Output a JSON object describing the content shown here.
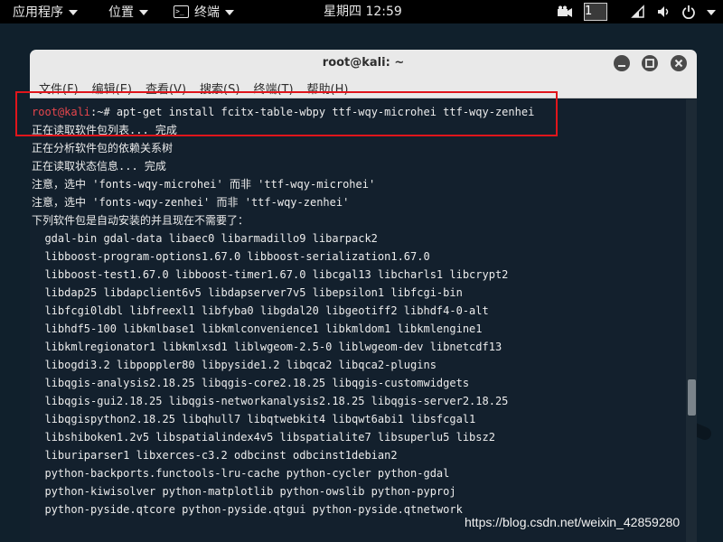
{
  "top_panel": {
    "apps_label": "应用程序",
    "places_label": "位置",
    "terminal_label": "终端",
    "clock": "星期四 12:59",
    "workspace": "1",
    "icons": [
      "camera-icon",
      "network-icon",
      "volume-icon",
      "power-icon"
    ]
  },
  "window": {
    "title": "root@kali: ~",
    "menus": [
      "文件(F)",
      "编辑(E)",
      "查看(V)",
      "搜索(S)",
      "终端(T)",
      "帮助(H)"
    ]
  },
  "terminal": {
    "prompt_user": "root@kali",
    "prompt_rest": ":~# apt-get install fcitx-table-wbpy ttf-wqy-microhei ttf-wqy-zenhei",
    "lines": [
      "正在读取软件包列表... 完成",
      "正在分析软件包的依赖关系树",
      "正在读取状态信息... 完成",
      "注意，选中 'fonts-wqy-microhei' 而非 'ttf-wqy-microhei'",
      "注意，选中 'fonts-wqy-zenhei' 而非 'ttf-wqy-zenhei'",
      "下列软件包是自动安装的并且现在不需要了：",
      "  gdal-bin gdal-data libaec0 libarmadillo9 libarpack2",
      "  libboost-program-options1.67.0 libboost-serialization1.67.0",
      "  libboost-test1.67.0 libboost-timer1.67.0 libcgal13 libcharls1 libcrypt2",
      "  libdap25 libdapclient6v5 libdapserver7v5 libepsilon1 libfcgi-bin",
      "  libfcgi0ldbl libfreexl1 libfyba0 libgdal20 libgeotiff2 libhdf4-0-alt",
      "  libhdf5-100 libkmlbase1 libkmlconvenience1 libkmldom1 libkmlengine1",
      "  libkmlregionator1 libkmlxsd1 liblwgeom-2.5-0 liblwgeom-dev libnetcdf13",
      "  libogdi3.2 libpoppler80 libpyside1.2 libqca2 libqca2-plugins",
      "  libqgis-analysis2.18.25 libqgis-core2.18.25 libqgis-customwidgets",
      "  libqgis-gui2.18.25 libqgis-networkanalysis2.18.25 libqgis-server2.18.25",
      "  libqgispython2.18.25 libqhull7 libqtwebkit4 libqwt6abi1 libsfcgal1",
      "  libshiboken1.2v5 libspatialindex4v5 libspatialite7 libsuperlu5 libsz2",
      "  liburiparser1 libxerces-c3.2 odbcinst odbcinst1debian2",
      "  python-backports.functools-lru-cache python-cycler python-gdal",
      "  python-kiwisolver python-matplotlib python-owslib python-pyproj",
      "  python-pyside.qtcore python-pyside.qtgui python-pyside.qtnetwork"
    ]
  },
  "watermark": "https://blog.csdn.net/weixin_42859280",
  "colors": {
    "prompt_user": "#e8464d",
    "highlight_box": "#e0151b",
    "terminal_bg": "#13202d"
  }
}
